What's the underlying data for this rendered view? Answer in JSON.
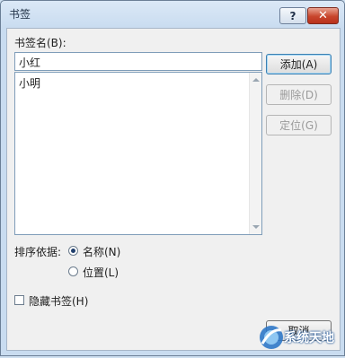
{
  "window": {
    "title": "书签",
    "help_label": "?",
    "close_label": "✕"
  },
  "bookmark_name": {
    "label": "书签名(B):",
    "value": "小红"
  },
  "bookmark_list": {
    "items": [
      "小明"
    ]
  },
  "buttons": {
    "add": "添加(A)",
    "delete": "删除(D)",
    "goto": "定位(G)",
    "cancel": "取消"
  },
  "sort": {
    "label": "排序依据:",
    "options": [
      {
        "label": "名称(N)",
        "selected": true
      },
      {
        "label": "位置(L)",
        "selected": false
      }
    ]
  },
  "hidden_bookmarks": {
    "label": "隐藏书签(H)",
    "checked": false
  },
  "watermark": {
    "text": "系统天地"
  }
}
